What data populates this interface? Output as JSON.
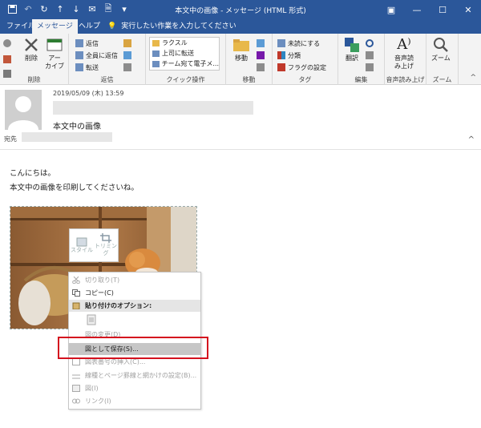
{
  "window": {
    "title": "本文中の画像 - メッセージ (HTML 形式)",
    "controls": [
      "restore",
      "minimize",
      "maximize",
      "close"
    ]
  },
  "tabs": [
    {
      "label": "ファイル",
      "active": false
    },
    {
      "label": "メッセージ",
      "active": true
    },
    {
      "label": "ヘルプ",
      "active": false
    }
  ],
  "tellme": {
    "text": "実行したい作業を入力してください"
  },
  "ribbon": {
    "delete_group": {
      "delete": "削除",
      "archive": "アー\nカイブ",
      "label": "削除"
    },
    "reply_group": {
      "reply": "返信",
      "reply_all": "全員に返信",
      "forward": "転送",
      "label": "返信"
    },
    "quick_steps": {
      "items": [
        "ラクスル",
        "上司に転送",
        "チーム宛て電子メ..."
      ],
      "label": "クイック操作"
    },
    "move_group": {
      "move": "移動",
      "label": "移動"
    },
    "tags_group": {
      "unread": "未読にする",
      "categorize": "分類",
      "flag": "フラグの設定",
      "label": "タグ"
    },
    "edit_group": {
      "translate": "翻訳",
      "label": "編集"
    },
    "speech_group": {
      "read_aloud": "音声読\nみ上げ",
      "label": "音声読み上げ"
    },
    "zoom_group": {
      "zoom": "ズーム",
      "label": "ズーム"
    }
  },
  "header": {
    "date": "2019/05/09 (木) 13:59",
    "subject": "本文中の画像",
    "to_label": "宛先"
  },
  "body": {
    "line1": "こんにちは。",
    "line2": "本文中の画像を印刷してくださいね。"
  },
  "mini_toolbar": {
    "style": "スタイル",
    "crop": "トリミング"
  },
  "context_menu": [
    {
      "label": "切り取り(T)",
      "state": "disabled"
    },
    {
      "label": "コピー(C)",
      "state": "normal"
    },
    {
      "label": "貼り付けのオプション:",
      "state": "header"
    },
    {
      "label": "",
      "state": "paste-icon"
    },
    {
      "label": "図の変更(D)",
      "state": "disabled"
    },
    {
      "label": "図として保存(S)...",
      "state": "highlighted"
    },
    {
      "label": "図表番号の挿入(C)...",
      "state": "disabled"
    },
    {
      "label": "線種とページ罫線と網かけの設定(B)...",
      "state": "disabled"
    },
    {
      "label": "図(I)",
      "state": "disabled"
    },
    {
      "label": "リンク(I)",
      "state": "disabled"
    }
  ],
  "colors": {
    "accent": "#2b579a",
    "ribbon_bg": "#f3f3f3",
    "highlight_box": "#d4111e"
  }
}
